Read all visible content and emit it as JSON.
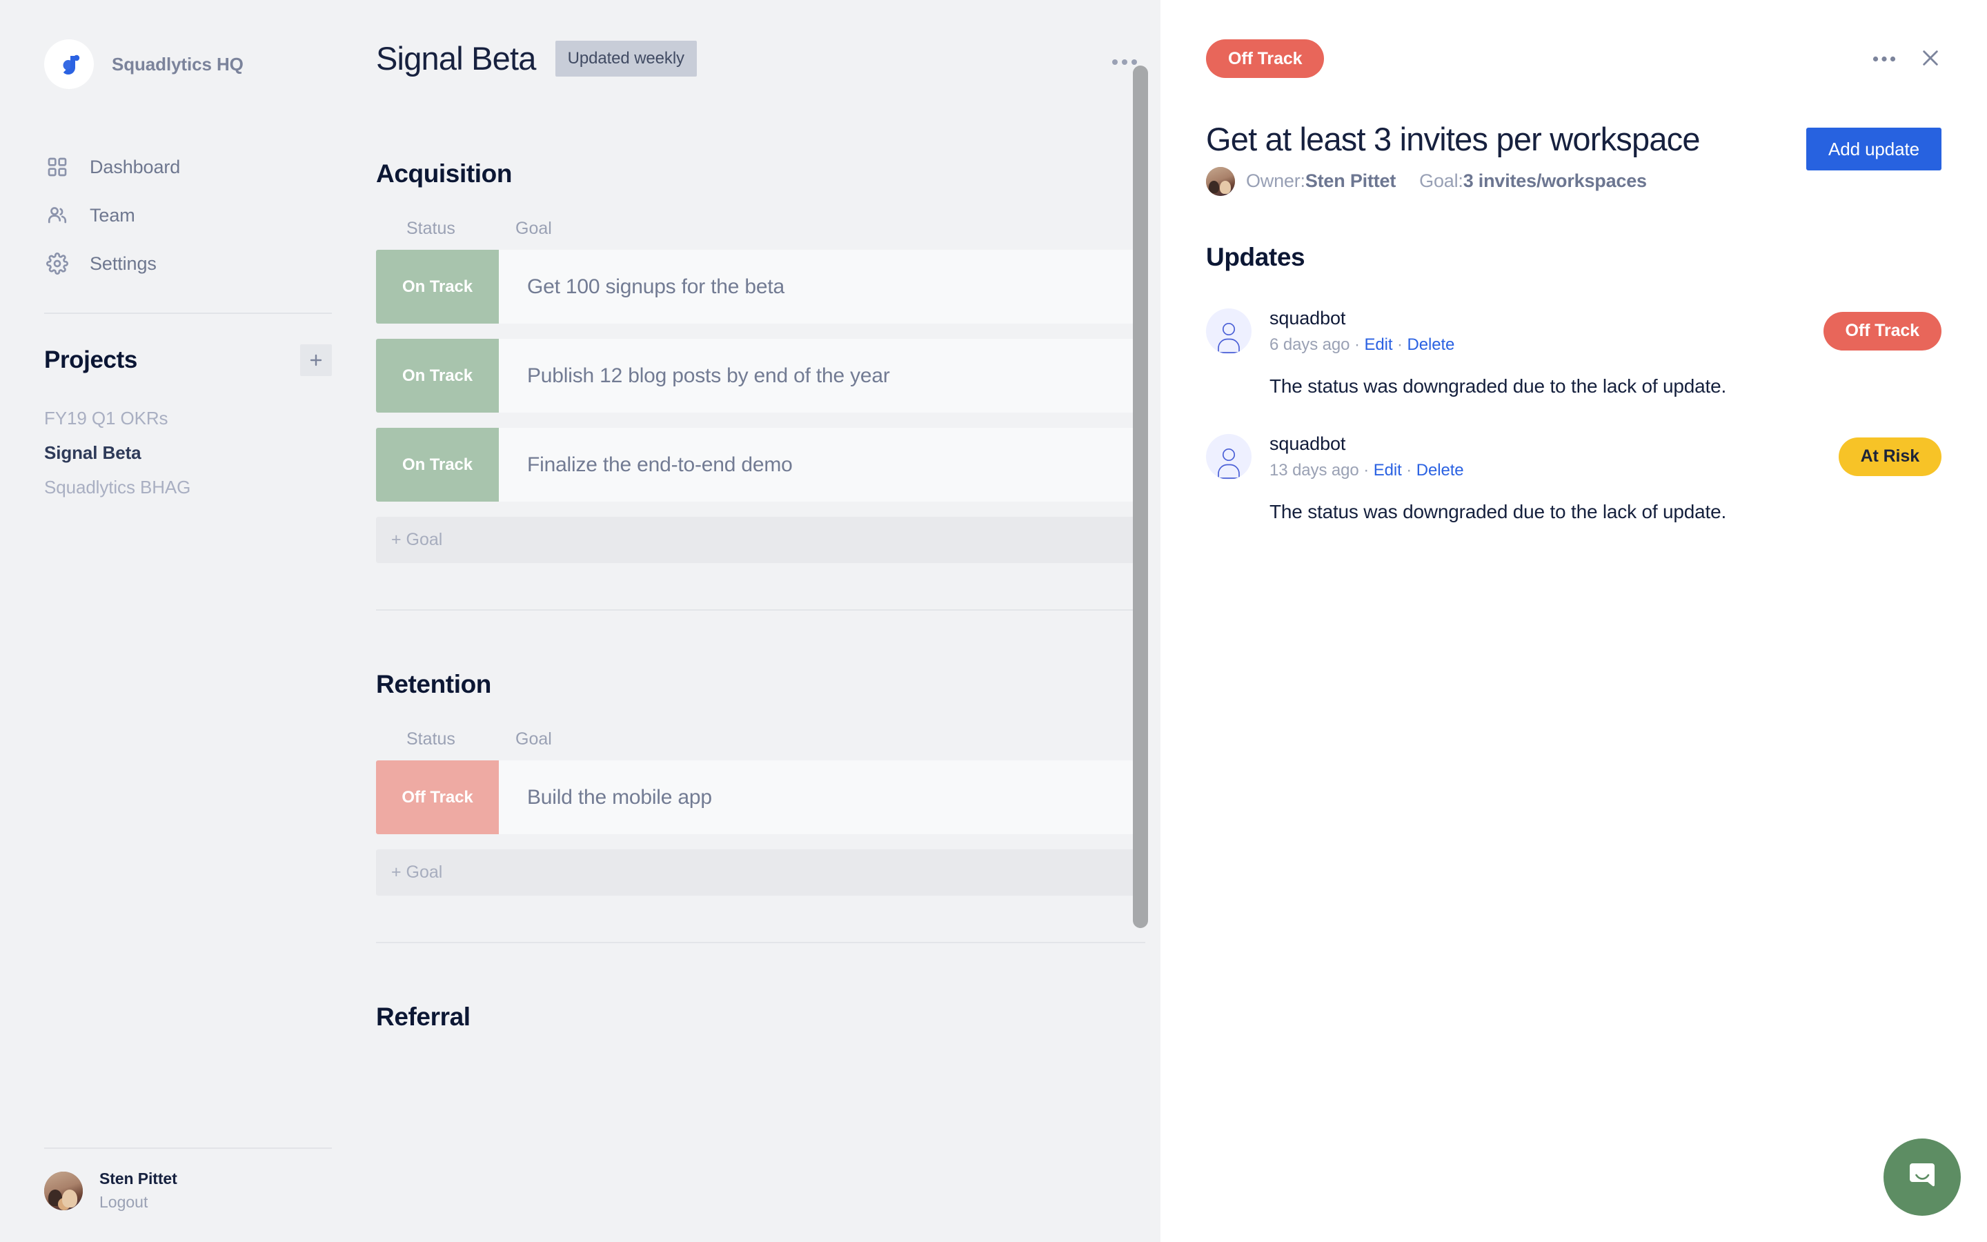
{
  "sidebar": {
    "brand": {
      "name": "Squadlytics HQ",
      "logo_icon": "squadlytics-logo"
    },
    "nav": [
      {
        "label": "Dashboard",
        "icon": "grid-icon"
      },
      {
        "label": "Team",
        "icon": "people-icon"
      },
      {
        "label": "Settings",
        "icon": "gear-icon"
      }
    ],
    "projects": {
      "title": "Projects",
      "add_icon": "plus-icon",
      "items": [
        {
          "label": "FY19 Q1 OKRs",
          "active": false
        },
        {
          "label": "Signal Beta",
          "active": true
        },
        {
          "label": "Squadlytics BHAG",
          "active": false
        }
      ]
    },
    "user": {
      "name": "Sten Pittet",
      "logout_label": "Logout",
      "avatar_icon": "user-avatar"
    }
  },
  "main": {
    "title": "Signal Beta",
    "badge": "Updated weekly",
    "menu_icon": "ellipsis-icon",
    "columns": {
      "status": "Status",
      "goal": "Goal"
    },
    "add_goal_label": "+ Goal",
    "sections": [
      {
        "title": "Acquisition",
        "goals": [
          {
            "status": "On Track",
            "status_key": "on-track",
            "label": "Get 100 signups for the beta"
          },
          {
            "status": "On Track",
            "status_key": "on-track",
            "label": "Publish 12 blog posts by end of the year"
          },
          {
            "status": "On Track",
            "status_key": "on-track",
            "label": "Finalize the end-to-end demo"
          }
        ]
      },
      {
        "title": "Retention",
        "goals": [
          {
            "status": "Off Track",
            "status_key": "off-track",
            "label": "Build the mobile app"
          }
        ]
      },
      {
        "title": "Referral",
        "goals": []
      }
    ]
  },
  "detail": {
    "status_pill": "Off Track",
    "menu_icon": "ellipsis-icon",
    "close_icon": "close-icon",
    "title": "Get at least 3 invites per workspace",
    "owner_label": "Owner:",
    "owner_name": "Sten Pittet",
    "goal_label": "Goal:",
    "goal_value": "3 invites/workspaces",
    "add_update_label": "Add update",
    "updates_title": "Updates",
    "updates": [
      {
        "author": "squadbot",
        "time": "6 days ago",
        "edit_label": "Edit",
        "delete_label": "Delete",
        "separator": "·",
        "status": "Off Track",
        "status_key": "off-track",
        "body": "The status was downgraded due to the lack of update."
      },
      {
        "author": "squadbot",
        "time": "13 days ago",
        "edit_label": "Edit",
        "delete_label": "Delete",
        "separator": "·",
        "status": "At Risk",
        "status_key": "at-risk",
        "body": "The status was downgraded due to the lack of update."
      }
    ]
  },
  "intercom": {
    "icon": "chat-bubble-icon"
  },
  "colors": {
    "background": "#f1f2f4",
    "panel": "#ffffff",
    "accent_blue": "#2762e0",
    "on_track": "#a8c4ad",
    "off_track": "#eeaaa3",
    "off_track_pill": "#e8665a",
    "at_risk": "#f7c327",
    "intercom_green": "#5d8d63",
    "text_dark": "#0c1734",
    "text_muted": "#9aa1b4"
  }
}
